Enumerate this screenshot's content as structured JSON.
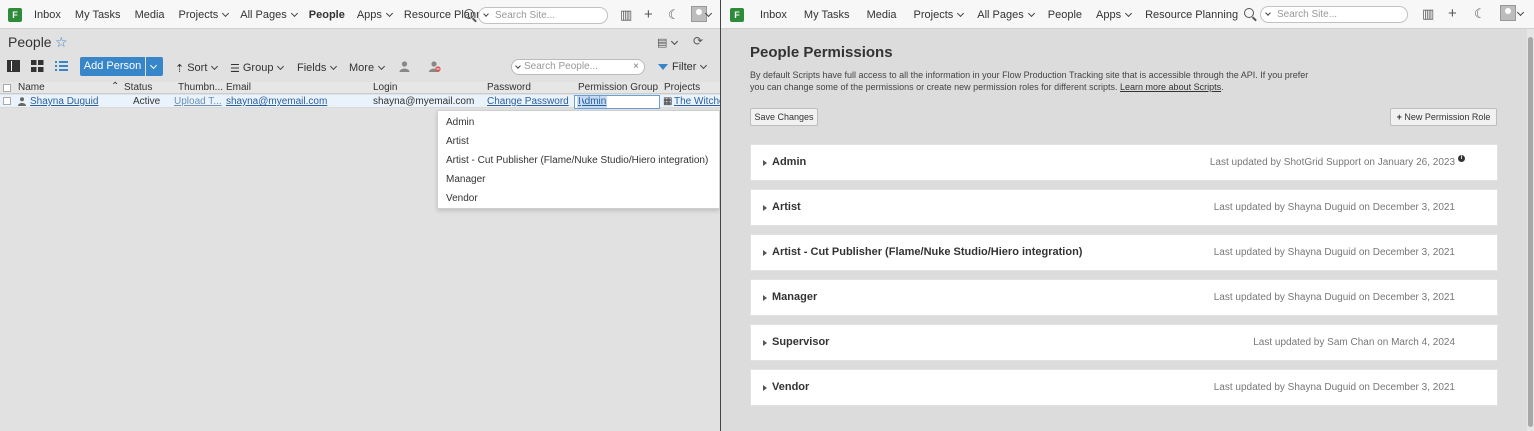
{
  "left": {
    "nav": {
      "items": [
        "Inbox",
        "My Tasks",
        "Media",
        "Projects",
        "All Pages",
        "People",
        "Apps",
        "Resource Planning"
      ],
      "search_placeholder": "Search Site..."
    },
    "page_title": "People",
    "toolbar": {
      "add_person": "Add Person",
      "sort": "Sort",
      "group": "Group",
      "fields": "Fields",
      "more": "More",
      "search_placeholder": "Search People...",
      "filter": "Filter"
    },
    "columns": [
      "Name",
      "Status",
      "Thumbn...",
      "Email",
      "Login",
      "Password",
      "Permission Group",
      "Projects"
    ],
    "row": {
      "name": "Shayna Duguid",
      "status": "Active",
      "thumbnail": "Upload T...",
      "email": "shayna@myemail.com",
      "login": "shayna@myemail.com",
      "password": "Change Password",
      "permission_group": "Admin",
      "projects": "The Witche"
    },
    "dropdown_options": [
      "Admin",
      "Artist",
      "Artist - Cut Publisher (Flame/Nuke Studio/Hiero integration)",
      "Manager",
      "Vendor"
    ]
  },
  "right": {
    "nav": {
      "items": [
        "Inbox",
        "My Tasks",
        "Media",
        "Projects",
        "All Pages",
        "People",
        "Apps",
        "Resource Planning"
      ],
      "search_placeholder": "Search Site..."
    },
    "title": "People Permissions",
    "desc_line1": "By default Scripts have full access to all the information in your Flow Production Tracking site that is accessible through the API. If you prefer",
    "desc_line2": "you can change some of the permissions or create new permission roles for different scripts.",
    "learn_more": "Learn more about Scripts",
    "save_changes": "Save Changes",
    "new_role": "New Permission Role",
    "roles": [
      {
        "name": "Admin",
        "updated": "Last updated by ShotGrid Support on January 26, 2023"
      },
      {
        "name": "Artist",
        "updated": "Last updated by Shayna Duguid on December 3, 2021"
      },
      {
        "name": "Artist - Cut Publisher (Flame/Nuke Studio/Hiero integration)",
        "updated": "Last updated by Shayna Duguid on December 3, 2021"
      },
      {
        "name": "Manager",
        "updated": "Last updated by Shayna Duguid on December 3, 2021"
      },
      {
        "name": "Supervisor",
        "updated": "Last updated by Sam Chan on March 4, 2024"
      },
      {
        "name": "Vendor",
        "updated": "Last updated by Shayna Duguid on December 3, 2021"
      }
    ]
  }
}
